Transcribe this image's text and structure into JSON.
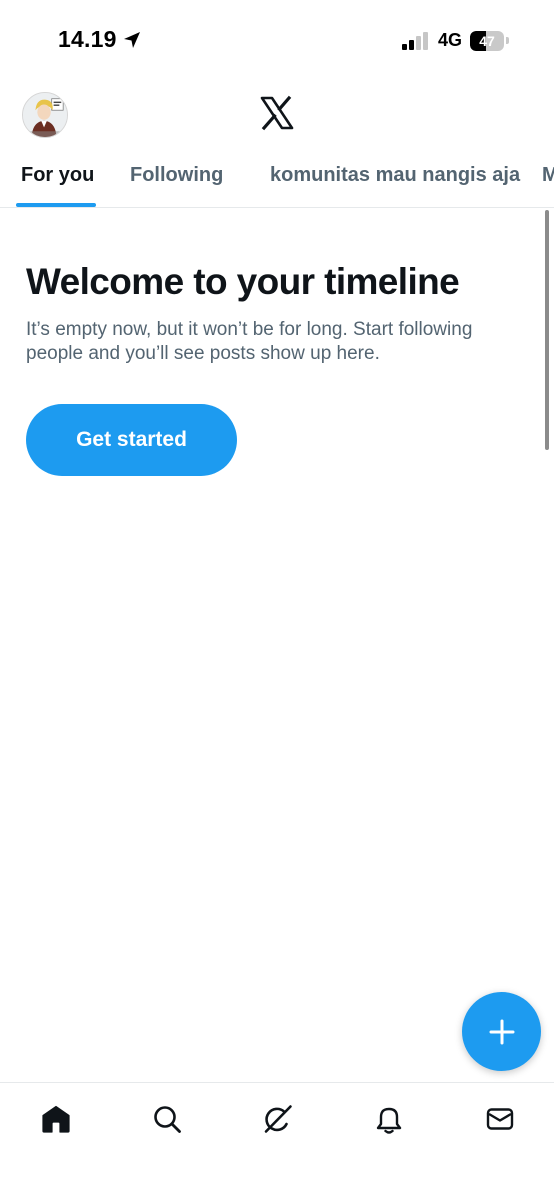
{
  "status_bar": {
    "time": "14.19",
    "network": "4G",
    "battery_percent": "47",
    "battery_level": 0.47,
    "location_icon": "location-arrow-icon",
    "signal_icon": "cellular-signal-icon"
  },
  "header": {
    "avatar_icon": "profile-avatar",
    "logo_icon": "x-logo-icon"
  },
  "tabs": [
    {
      "label": "For you",
      "active": true
    },
    {
      "label": "Following",
      "active": false
    },
    {
      "label": "komunitas mau nangis aja",
      "active": false
    },
    {
      "label": "M",
      "active": false
    }
  ],
  "main": {
    "title": "Welcome to your timeline",
    "body": "It’s empty now, but it won’t be for long. Start following people and you’ll see posts show up here.",
    "cta_label": "Get started"
  },
  "fab": {
    "icon": "plus-icon"
  },
  "bottom_nav": [
    {
      "icon": "home-icon",
      "active": true
    },
    {
      "icon": "search-icon",
      "active": false
    },
    {
      "icon": "grok-icon",
      "active": false
    },
    {
      "icon": "notifications-bell-icon",
      "active": false
    },
    {
      "icon": "messages-envelope-icon",
      "active": false
    }
  ],
  "colors": {
    "accent": "#1d9bf0",
    "text_primary": "#0f1419",
    "text_secondary": "#536471"
  }
}
